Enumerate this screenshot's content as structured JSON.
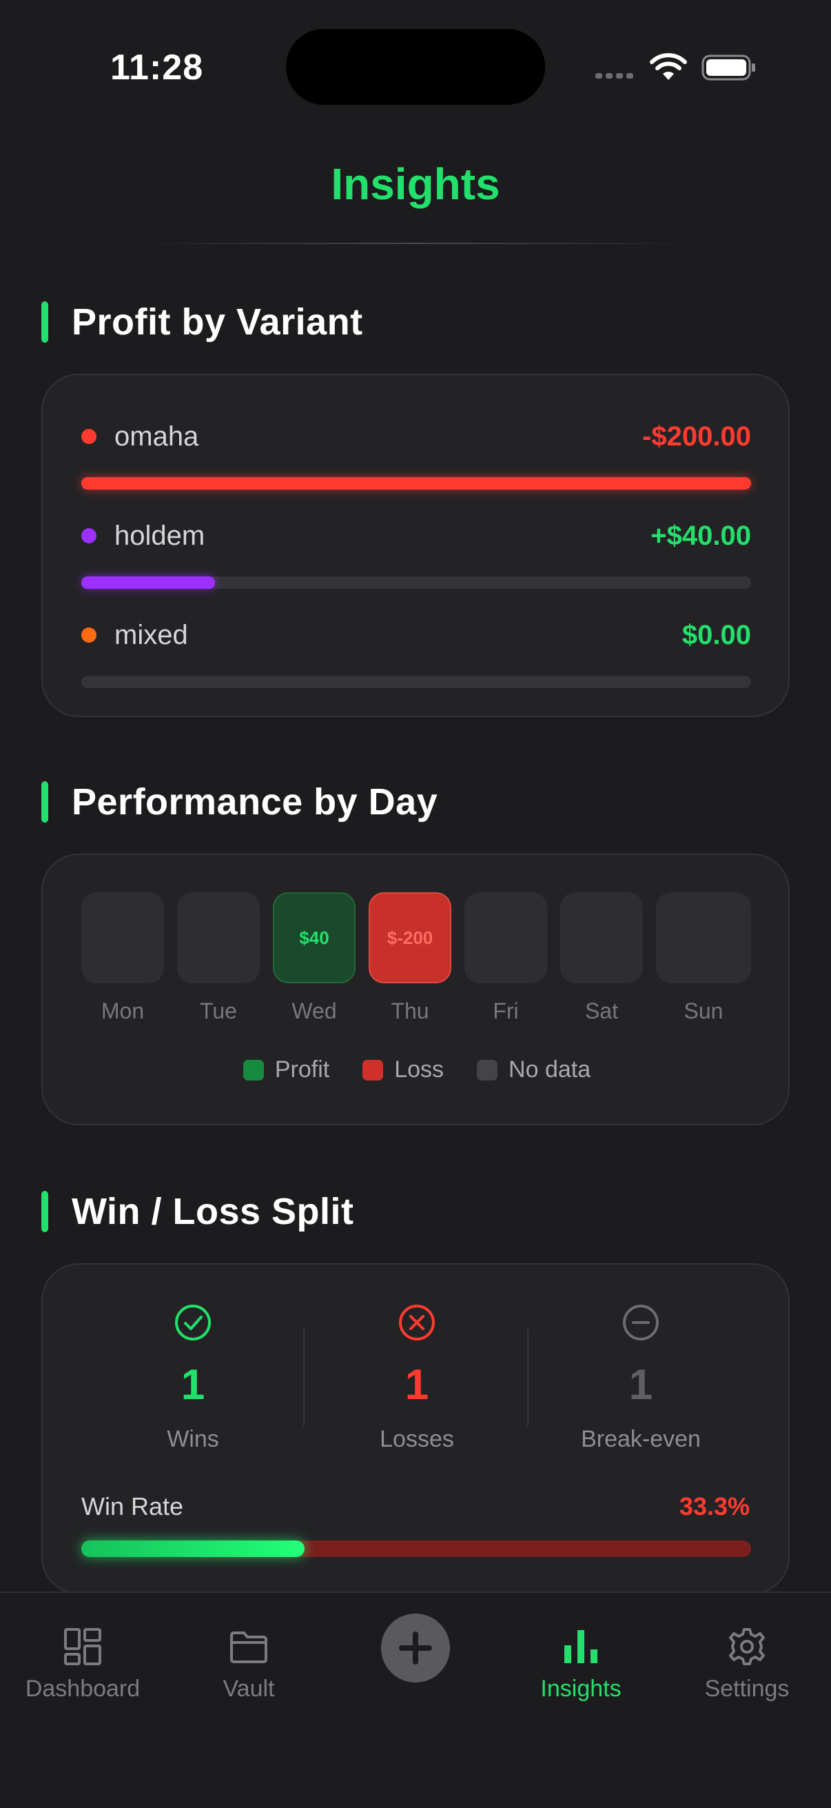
{
  "status_bar": {
    "time": "11:28"
  },
  "header": {
    "title": "Insights"
  },
  "sections": {
    "variant": {
      "title": "Profit by Variant"
    },
    "day": {
      "title": "Performance by Day"
    },
    "winloss": {
      "title": "Win / Loss Split"
    }
  },
  "variants": [
    {
      "name": "omaha",
      "amount": "-$200.00",
      "dot_color": "#ff3b30",
      "amount_color": "#ff3b30",
      "bar_color": "#ff3b30",
      "bar_fraction": 1.0
    },
    {
      "name": "holdem",
      "amount": "+$40.00",
      "dot_color": "#9b30ff",
      "amount_color": "#22e06b",
      "bar_color": "#9b30ff",
      "bar_fraction": 0.2
    },
    {
      "name": "mixed",
      "amount": "$0.00",
      "dot_color": "#ff6a13",
      "amount_color": "#22e06b",
      "bar_color": "#ff6a13",
      "bar_fraction": 0.0
    }
  ],
  "days": [
    {
      "label": "Mon",
      "value": "",
      "status": "none"
    },
    {
      "label": "Tue",
      "value": "",
      "status": "none"
    },
    {
      "label": "Wed",
      "value": "$40",
      "status": "profit"
    },
    {
      "label": "Thu",
      "value": "$-200",
      "status": "loss"
    },
    {
      "label": "Fri",
      "value": "",
      "status": "none"
    },
    {
      "label": "Sat",
      "value": "",
      "status": "none"
    },
    {
      "label": "Sun",
      "value": "",
      "status": "none"
    }
  ],
  "legend": {
    "profit": "Profit",
    "loss": "Loss",
    "nodata": "No data"
  },
  "winloss": {
    "wins": {
      "count": "1",
      "label": "Wins"
    },
    "losses": {
      "count": "1",
      "label": "Losses"
    },
    "breakeven": {
      "count": "1",
      "label": "Break-even"
    },
    "win_rate_label": "Win Rate",
    "win_rate_value": "33.3%",
    "win_rate_fraction": 0.333
  },
  "tabs": [
    {
      "label": "Dashboard",
      "icon": "dashboard-icon"
    },
    {
      "label": "Vault",
      "icon": "folder-icon"
    },
    {
      "label": "",
      "icon": "plus-icon"
    },
    {
      "label": "Insights",
      "icon": "bar-chart-icon",
      "active": true
    },
    {
      "label": "Settings",
      "icon": "gear-icon"
    }
  ],
  "colors": {
    "accent": "#22e06b",
    "loss": "#ff3b30",
    "background": "#1c1c1e",
    "card": "#232325"
  }
}
